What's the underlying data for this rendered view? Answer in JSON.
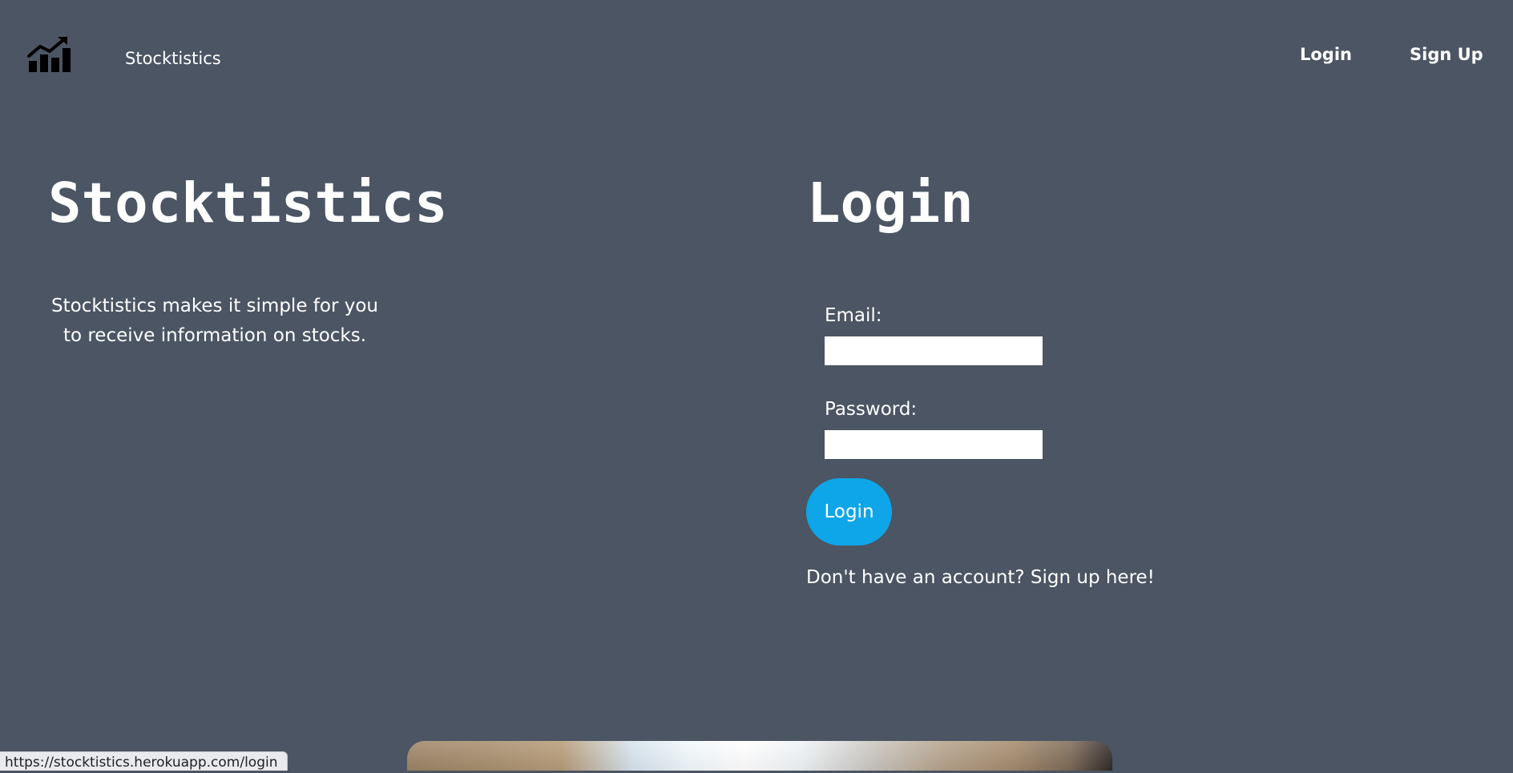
{
  "navbar": {
    "logo_icon": "chart-growth-icon",
    "brand": "Stocktistics",
    "links": {
      "login": "Login",
      "signup": "Sign Up"
    }
  },
  "hero": {
    "title": "Stocktistics",
    "description": "Stocktistics makes it simple for you to receive information on stocks."
  },
  "login_form": {
    "title": "Login",
    "email_label": "Email:",
    "email_value": "",
    "password_label": "Password:",
    "password_value": "",
    "submit_label": "Login",
    "signup_prompt": "Don't have an account? Sign up here!"
  },
  "status_bar": {
    "url": "https://stocktistics.herokuapp.com/login"
  },
  "colors": {
    "background": "#4b5563",
    "accent": "#0ea5e9",
    "text": "#ffffff"
  }
}
